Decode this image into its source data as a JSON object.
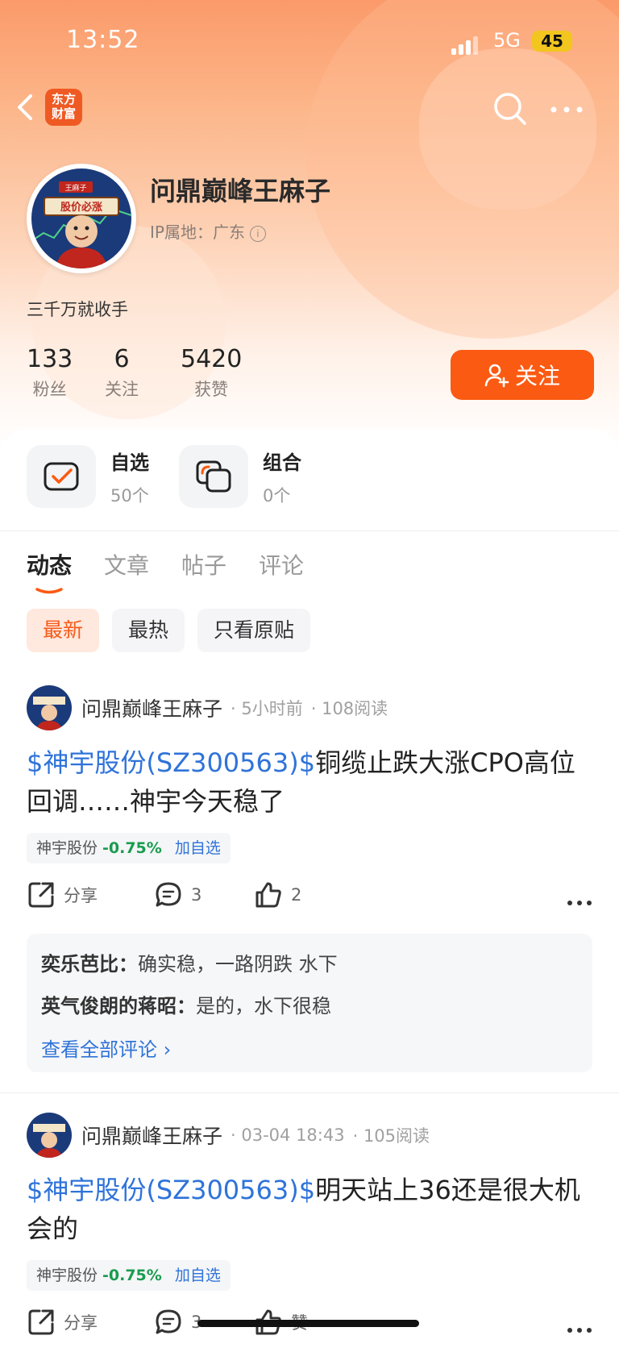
{
  "status_bar": {
    "time": "13:52",
    "network": "5G",
    "battery": "45"
  },
  "header": {
    "logo_text_top": "东方",
    "logo_text_bottom": "财富"
  },
  "profile": {
    "name": "问鼎巅峰王麻子",
    "ip_label": "IP属地：广东",
    "bio": "三千万就收手",
    "avatar_sign": "股价必涨",
    "avatar_badge": "王麻子",
    "stats": [
      {
        "num": "133",
        "label": "粉丝"
      },
      {
        "num": "6",
        "label": "关注"
      },
      {
        "num": "5420",
        "label": "获赞"
      }
    ],
    "follow_label": "关注"
  },
  "quick": [
    {
      "title": "自选",
      "count": "50个"
    },
    {
      "title": "组合",
      "count": "0个"
    }
  ],
  "tabs": [
    "动态",
    "文章",
    "帖子",
    "评论"
  ],
  "filters": [
    "最新",
    "最热",
    "只看原贴"
  ],
  "posts": [
    {
      "author": "问鼎巅峰王麻子",
      "time": "· 5小时前",
      "reads": "· 108阅读",
      "tag": "$神宇股份(SZ300563)$",
      "text_line1": "铜缆止跌大涨CPO高位",
      "text_line2": "回调……神宇今天稳了",
      "stock_name": "神宇股份",
      "stock_change": "-0.75%",
      "stock_add": "加自选",
      "share": "分享",
      "comments": "3",
      "likes": "2"
    },
    {
      "author": "问鼎巅峰王麻子",
      "time": "· 03-04 18:43",
      "reads": "· 105阅读",
      "tag": "$神宇股份(SZ300563)$",
      "text_line1": "明天站上36还是很大机",
      "text_line2": "会的",
      "stock_name": "神宇股份",
      "stock_change": "-0.75%",
      "stock_add": "加自选",
      "share": "分享",
      "comments": "3",
      "likes": "赞"
    }
  ],
  "comment_preview": [
    {
      "user": "奕乐芭比：",
      "text": "确实稳，一路阴跌 水下"
    },
    {
      "user": "英气俊朗的蒋昭：",
      "text": "是的，水下很稳"
    }
  ],
  "view_all_comments": "查看全部评论 ›",
  "colors": {
    "accent": "#fb5a12",
    "link": "#2f73d9",
    "down": "#1a9c4e"
  }
}
